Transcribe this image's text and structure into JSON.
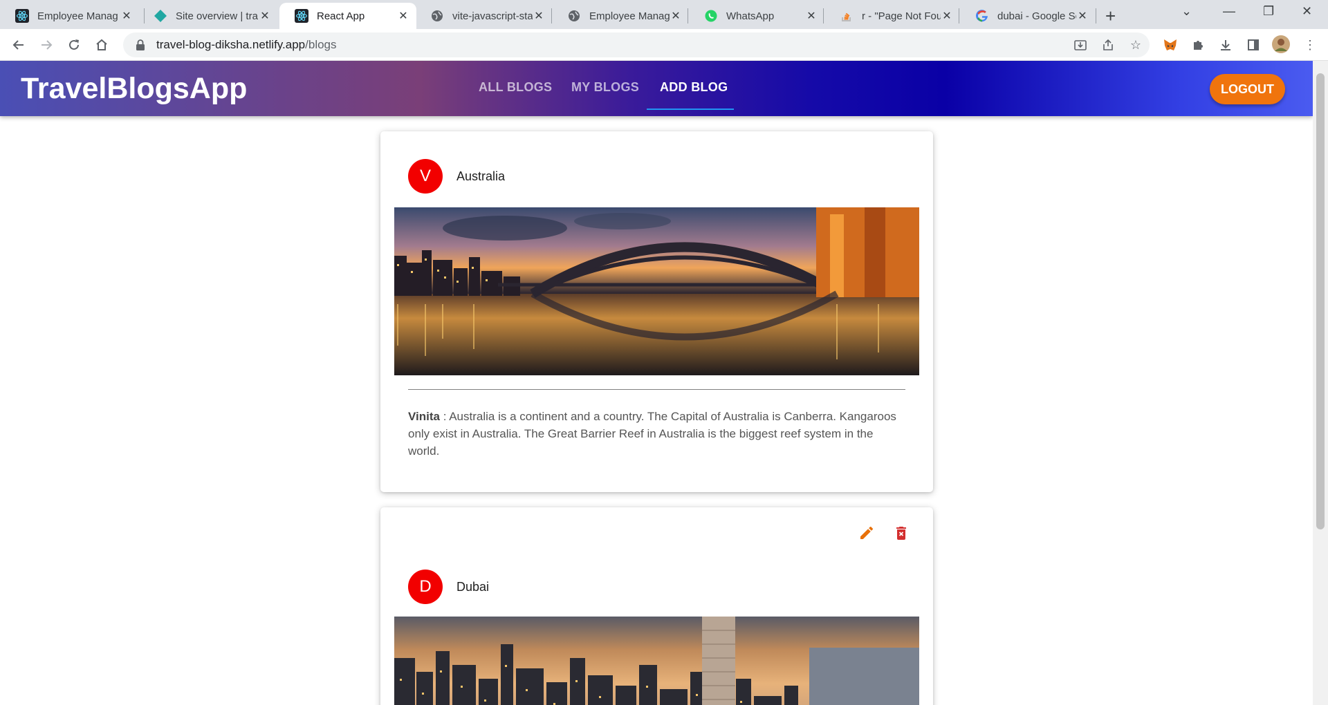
{
  "browser": {
    "tabs": [
      {
        "title": "Employee Manag",
        "icon": "react-icon",
        "active": false
      },
      {
        "title": "Site overview | tra",
        "icon": "netlify-icon",
        "active": false
      },
      {
        "title": "React App",
        "icon": "react-icon",
        "active": true
      },
      {
        "title": "vite-javascript-sta",
        "icon": "globe-icon",
        "active": false
      },
      {
        "title": "Employee Manag",
        "icon": "globe-icon",
        "active": false
      },
      {
        "title": "WhatsApp",
        "icon": "whatsapp-icon",
        "active": false
      },
      {
        "title": "r - \"Page Not Fou",
        "icon": "stackoverflow-icon",
        "active": false
      },
      {
        "title": "dubai - Google Se",
        "icon": "google-icon",
        "active": false
      }
    ],
    "url_host": "travel-blog-diksha.netlify.app",
    "url_path": "/blogs"
  },
  "app": {
    "brand": "TravelBlogsApp",
    "nav": {
      "all_blogs": "ALL BLOGS",
      "my_blogs": "MY BLOGS",
      "add_blog": "ADD BLOG"
    },
    "logout": "LOGOUT",
    "colors": {
      "avatar": "#f20000",
      "logout": "#f0740d",
      "edit": "#e8710a",
      "delete": "#d32f2f",
      "indicator": "#2196f3"
    }
  },
  "blogs": [
    {
      "avatar_letter": "V",
      "title": "Australia",
      "author": "Vinita",
      "separator": " : ",
      "description": "Australia is a continent and a country. The Capital of Australia is Canberra. Kangaroos only exist in Australia. The Great Barrier Reef in Australia is the biggest reef system in the world.",
      "image": "sydney-harbour-bridge-at-sunset",
      "editable": false
    },
    {
      "avatar_letter": "D",
      "title": "Dubai",
      "image": "dubai-skyline-at-dusk",
      "editable": true
    }
  ]
}
